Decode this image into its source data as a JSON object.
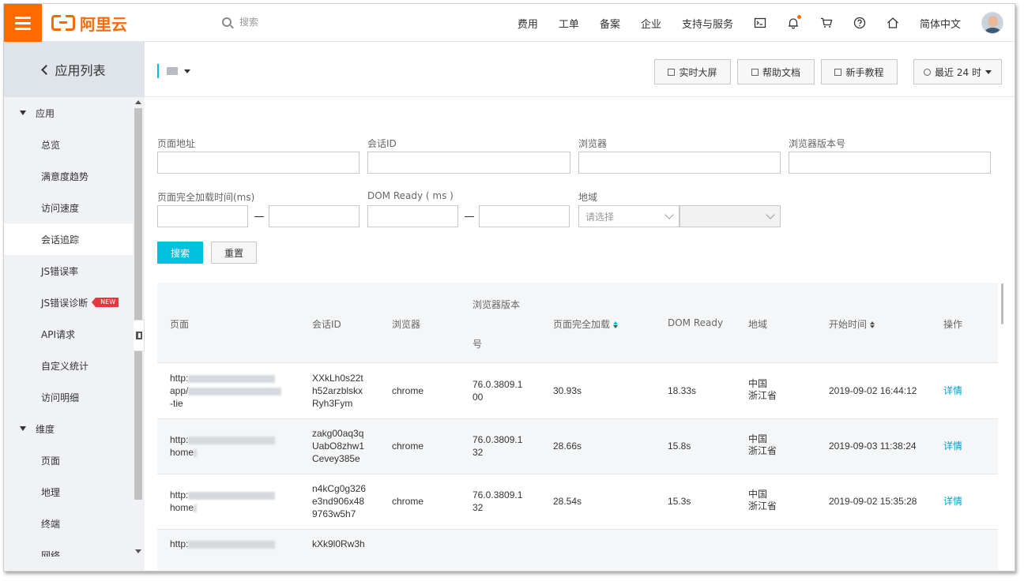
{
  "topbar": {
    "logo_text": "阿里云",
    "search_placeholder": "搜索",
    "nav": [
      "费用",
      "工单",
      "备案",
      "企业",
      "支持与服务"
    ],
    "language": "简体中文",
    "icons": [
      "terminal-icon",
      "bell-icon",
      "cart-icon",
      "help-icon",
      "home-icon"
    ]
  },
  "sidebar": {
    "back_label": "应用列表",
    "groups": [
      {
        "label": "应用",
        "items": [
          "总览",
          "满意度趋势",
          "访问速度",
          "会话追踪",
          "JS错误率",
          "JS错误诊断",
          "API请求",
          "自定义统计",
          "访问明细"
        ]
      },
      {
        "label": "维度",
        "items": [
          "页面",
          "地理",
          "终端",
          "网络"
        ]
      }
    ],
    "active_item": "会话追踪",
    "new_badge": "NEW"
  },
  "toolbar": {
    "buttons": [
      "实时大屏",
      "帮助文档",
      "新手教程"
    ],
    "time_range": "最近 24 时"
  },
  "filters": {
    "page_url_label": "页面地址",
    "session_id_label": "会话ID",
    "browser_label": "浏览器",
    "browser_version_label": "浏览器版本号",
    "load_time_label": "页面完全加载时间(ms)",
    "dom_ready_label": "DOM Ready ( ms )",
    "region_label": "地域",
    "region_placeholder": "请选择",
    "search_button": "搜索",
    "reset_button": "重置"
  },
  "table": {
    "headers": {
      "page": "页面",
      "session_id": "会话ID",
      "browser": "浏览器",
      "browser_version_top": "浏览器版本",
      "browser_version_bottom": "号",
      "load_time": "页面完全加载",
      "dom_ready": "DOM Ready",
      "region": "地域",
      "start_time": "开始时间",
      "action": "操作"
    },
    "rows": [
      {
        "page_l1": "http:",
        "page_l2": "app/",
        "page_l3": "-tie",
        "session_l1": "XXkLh0s22t",
        "session_l2": "h52arzblskx",
        "session_l3": "Ryh3Fym",
        "browser": "chrome",
        "version_l1": "76.0.3809.1",
        "version_l2": "00",
        "load_time": "30.93s",
        "dom_ready": "18.33s",
        "region_l1": "中国",
        "region_l2": "浙江省",
        "start_time": "2019-09-02 16:44:12",
        "action": "详情"
      },
      {
        "page_l1": "http:",
        "page_l2": "home",
        "page_l3": "",
        "session_l1": "zakg00aq3q",
        "session_l2": "UabO8zhw1",
        "session_l3": "Cevey385e",
        "browser": "chrome",
        "version_l1": "76.0.3809.1",
        "version_l2": "32",
        "load_time": "28.66s",
        "dom_ready": "15.8s",
        "region_l1": "中国",
        "region_l2": "浙江省",
        "start_time": "2019-09-03 11:38:24",
        "action": "详情"
      },
      {
        "page_l1": "http:",
        "page_l2": "home",
        "page_l3": "",
        "session_l1": "n4kCg0g326",
        "session_l2": "e3nd906x48",
        "session_l3": "9763w5h7",
        "browser": "chrome",
        "version_l1": "76.0.3809.1",
        "version_l2": "32",
        "load_time": "28.54s",
        "dom_ready": "15.3s",
        "region_l1": "中国",
        "region_l2": "浙江省",
        "start_time": "2019-09-02 15:35:28",
        "action": "详情"
      },
      {
        "page_l1": "http:",
        "session_l1": "kXk9l0Rw3h"
      }
    ]
  },
  "colors": {
    "brand": "#ff6a00",
    "accent": "#00c1de",
    "link": "#00a2ca"
  }
}
